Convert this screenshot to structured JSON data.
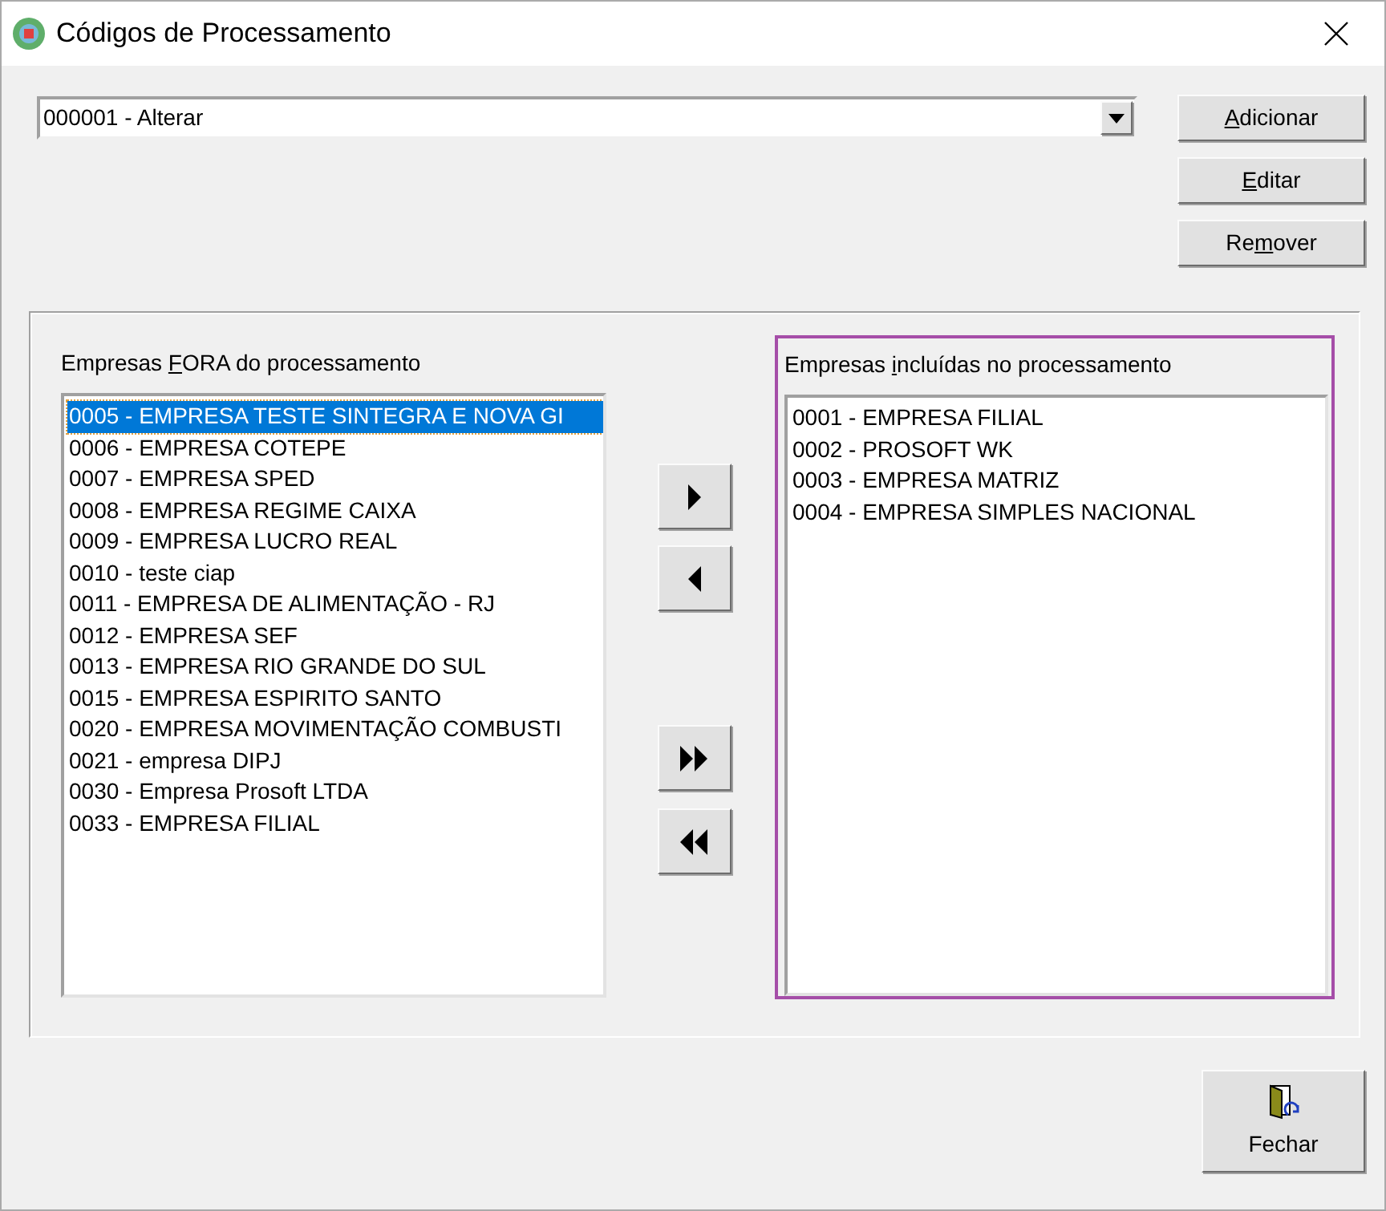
{
  "window": {
    "title": "Códigos de Processamento"
  },
  "combo": {
    "value": "000001 - Alterar"
  },
  "side_buttons": [
    {
      "key": "A",
      "post": "dicionar"
    },
    {
      "key": "E",
      "post": "ditar"
    },
    {
      "pre": "Re",
      "key": "m",
      "post": "over"
    }
  ],
  "left_list": {
    "label": {
      "pre": "Empresas ",
      "key": "F",
      "post": "ORA do processamento"
    },
    "items": [
      {
        "text": "0005 - EMPRESA TESTE SINTEGRA E NOVA GI",
        "selected": true
      },
      {
        "text": "0006 - EMPRESA COTEPE",
        "selected": false
      },
      {
        "text": "0007 - EMPRESA SPED",
        "selected": false
      },
      {
        "text": "0008 - EMPRESA REGIME CAIXA",
        "selected": false
      },
      {
        "text": "0009 - EMPRESA LUCRO REAL",
        "selected": false
      },
      {
        "text": "0010 - teste ciap",
        "selected": false
      },
      {
        "text": "0011 - EMPRESA DE ALIMENTAÇÃO - RJ",
        "selected": false
      },
      {
        "text": "0012 - EMPRESA SEF",
        "selected": false
      },
      {
        "text": "0013 - EMPRESA RIO GRANDE DO SUL",
        "selected": false
      },
      {
        "text": "0015 - EMPRESA ESPIRITO SANTO",
        "selected": false
      },
      {
        "text": "0020 - EMPRESA MOVIMENTAÇÃO COMBUSTI",
        "selected": false
      },
      {
        "text": "0021 - empresa DIPJ",
        "selected": false
      },
      {
        "text": "0030 - Empresa Prosoft LTDA",
        "selected": false
      },
      {
        "text": "0033 - EMPRESA FILIAL",
        "selected": false
      }
    ]
  },
  "move_buttons": [
    {
      "kind": "right"
    },
    {
      "kind": "left"
    },
    {
      "kind": "all_right"
    },
    {
      "kind": "all_left"
    }
  ],
  "right_list": {
    "focused": true,
    "label": {
      "pre": "Empresas ",
      "key": "i",
      "post": "ncluídas no processamento"
    },
    "items": [
      {
        "text": "0001 - EMPRESA FILIAL",
        "selected": false
      },
      {
        "text": "0002 - PROSOFT WK",
        "selected": false
      },
      {
        "text": "0003 - EMPRESA MATRIZ",
        "selected": false
      },
      {
        "text": "0004 - EMPRESA SIMPLES NACIONAL",
        "selected": false
      }
    ]
  },
  "close_button": {
    "label": "Fechar"
  }
}
